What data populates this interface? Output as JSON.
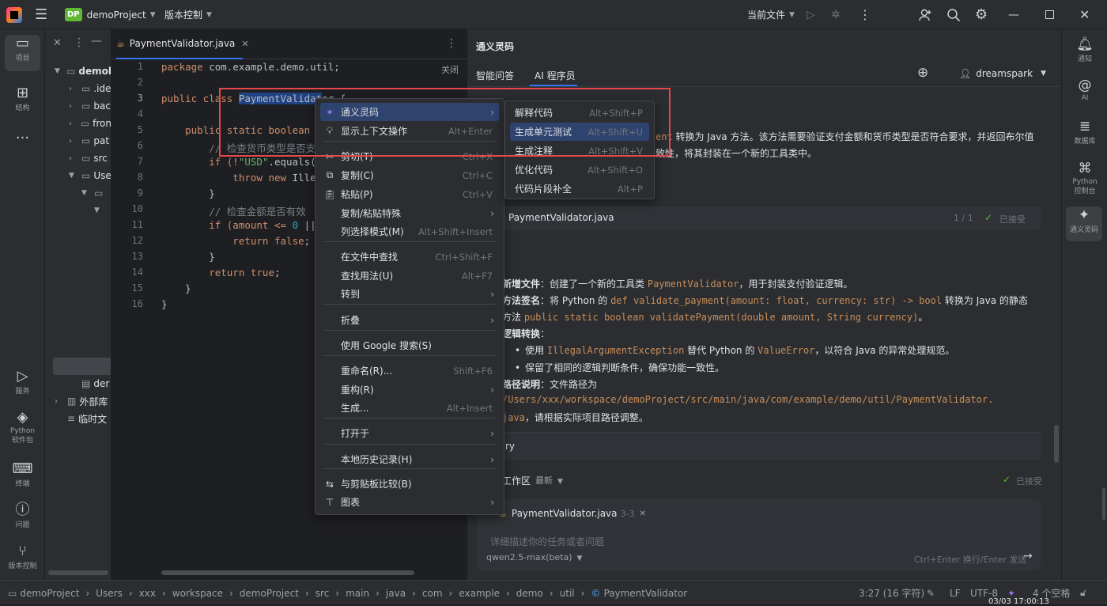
{
  "titlebar": {
    "logo_text": "",
    "project_badge": "DP",
    "project_name": "demoProject",
    "vcs_label": "版本控制",
    "run_config": "当前文件"
  },
  "left_strip": {
    "project": "项目",
    "structure": "结构",
    "more": "...",
    "services": "服务",
    "python_packages": "Python 软件包",
    "terminal": "终端",
    "problems": "问题",
    "vcs": "版本控制"
  },
  "project_tree": {
    "root": "demol",
    "items": [
      ".ide",
      "bac",
      "fron",
      "pat",
      "src",
      "Use",
      "",
      ""
    ],
    "lower": [
      "der",
      "外部库",
      "临时文"
    ]
  },
  "editor": {
    "tab_name": "PaymentValidator.java",
    "close_label": "关闭",
    "line_numbers": [
      "1",
      "2",
      "3",
      "4",
      "5",
      "6",
      "7",
      "8",
      "9",
      "10",
      "11",
      "12",
      "13",
      "14",
      "15",
      "16"
    ],
    "lines": {
      "l1_kw": "package",
      "l1_rest": " com.example.demo.util;",
      "l3_kw": "public class ",
      "l3_sel": "PaymentValidat",
      "l3_rest": "or {",
      "l5_kw": "    public static boolean ",
      "l5_rest": "v",
      "l6": "        // 检查货币类型是否支持",
      "l7_a": "        if (!",
      "l7_str": "\"USD\"",
      "l7_b": ".equals(c",
      "l8_kw": "            throw new ",
      "l8_rest": "Illeg",
      "l9": "        }",
      "l10": "        // 检查金额是否有效",
      "l11_a": "        if (amount <= ",
      "l11_num": "0",
      "l11_b": " ||",
      "l12_kw": "            return false",
      "l12_b": ";",
      "l13": "        }",
      "l14_kw": "        return true",
      "l14_b": ";",
      "l15": "    }",
      "l16": "}"
    }
  },
  "context_menu": {
    "items": [
      {
        "label": "通义灵码",
        "shortcut": "",
        "arrow": "›",
        "icon": "tongyi-icon"
      },
      {
        "label": "显示上下文操作",
        "shortcut": "Alt+Enter",
        "arrow": "",
        "icon": "bulb-icon"
      },
      {
        "label": "剪切(T)",
        "shortcut": "Ctrl+X",
        "arrow": "",
        "icon": "cut-icon"
      },
      {
        "label": "复制(C)",
        "shortcut": "Ctrl+C",
        "arrow": "",
        "icon": "copy-icon"
      },
      {
        "label": "粘贴(P)",
        "shortcut": "Ctrl+V",
        "arrow": "",
        "icon": "paste-icon"
      },
      {
        "label": "复制/粘贴特殊",
        "shortcut": "",
        "arrow": "›",
        "icon": ""
      },
      {
        "label": "列选择模式(M)",
        "shortcut": "Alt+Shift+Insert",
        "arrow": "",
        "icon": ""
      },
      {
        "label": "在文件中查找",
        "shortcut": "Ctrl+Shift+F",
        "arrow": "",
        "icon": ""
      },
      {
        "label": "查找用法(U)",
        "shortcut": "Alt+F7",
        "arrow": "",
        "icon": ""
      },
      {
        "label": "转到",
        "shortcut": "",
        "arrow": "›",
        "icon": ""
      },
      {
        "label": "折叠",
        "shortcut": "",
        "arrow": "›",
        "icon": ""
      },
      {
        "label": "使用 Google 搜索(S)",
        "shortcut": "",
        "arrow": "",
        "icon": ""
      },
      {
        "label": "重命名(R)...",
        "shortcut": "Shift+F6",
        "arrow": "",
        "icon": ""
      },
      {
        "label": "重构(R)",
        "shortcut": "",
        "arrow": "›",
        "icon": ""
      },
      {
        "label": "生成...",
        "shortcut": "Alt+Insert",
        "arrow": "",
        "icon": ""
      },
      {
        "label": "打开于",
        "shortcut": "",
        "arrow": "›",
        "icon": ""
      },
      {
        "label": "本地历史记录(H)",
        "shortcut": "",
        "arrow": "›",
        "icon": ""
      },
      {
        "label": "与剪贴板比较(B)",
        "shortcut": "",
        "arrow": "",
        "icon": "compare-icon"
      },
      {
        "label": "图表",
        "shortcut": "",
        "arrow": "›",
        "icon": "diagram-icon"
      }
    ]
  },
  "submenu": {
    "items": [
      {
        "label": "解释代码",
        "shortcut": "Alt+Shift+P"
      },
      {
        "label": "生成单元测试",
        "shortcut": "Alt+Shift+U"
      },
      {
        "label": "生成注释",
        "shortcut": "Alt+Shift+V"
      },
      {
        "label": "优化代码",
        "shortcut": "Alt+Shift+O"
      },
      {
        "label": "代码片段补全",
        "shortcut": "Alt+P"
      }
    ]
  },
  "ai_panel": {
    "title": "通义灵码",
    "tab_qa": "智能问答",
    "tab_agent": "AI 程序员",
    "user": "dreamspark",
    "intro_tail_code": "ent",
    "intro_line1": " 转换为 Java 方法。该方法需要验证支付金额和货币类型是否符合要求，并返回布尔值",
    "intro_line2": "致性，将其封装在一个新的工具类中。",
    "file_card": {
      "name": "PaymentValidator.java",
      "count": "1 / 1",
      "status": "已接受"
    },
    "bullets": {
      "b1_label": "新增文件",
      "b1_text": "：创建了一个新的工具类 ",
      "b1_code": "PaymentValidator",
      "b1_tail": "，用于封装支付验证逻辑。",
      "b2_label": "方法签名",
      "b2_text": "：将 Python 的 ",
      "b2_code": "def validate_payment(amount: float, currency: str) -> bool",
      "b2_tail": " 转换为 Java 的静态",
      "b2_line2_a": "方法 ",
      "b2_line2_code": "public static boolean validatePayment(double amount, String currency)",
      "b2_line2_b": "。",
      "b3_label": "逻辑转换",
      "b3_colon": "：",
      "b3_s1_a": "使用 ",
      "b3_s1_code": "IllegalArgumentException",
      "b3_s1_b": " 替代 Python 的 ",
      "b3_s1_code2": "ValueError",
      "b3_s1_c": "，以符合 Java 的异常处理规范。",
      "b3_s2": "保留了相同的逻辑判断条件，确保功能一致性。",
      "b4_label": "路径说明",
      "b4_text": "：文件路径为",
      "b4_path1": "/Users/xxx/workspace/demoProject/src/main/java/com/example/demo/util/PaymentValidator.",
      "b4_path2": "java",
      "b4_tail": "，请根据实际项目路径调整。"
    },
    "history_tail": "ry",
    "workspace_label": "工作区",
    "workspace_filter": "最新",
    "workspace_status": "已接受",
    "chip_file": "PaymentValidator.java",
    "chip_range": "3-3",
    "input_placeholder": "详细描述你的任务或者问题",
    "model": "qwen2.5-max(beta)",
    "send_hint": "Ctrl+Enter 换行/Enter 发送"
  },
  "right_strip": {
    "notify": "通知",
    "ai": "AI",
    "database": "数据库",
    "python_console": "Python 控制台",
    "tongyi": "通义灵码"
  },
  "statusbar": {
    "breadcrumb": [
      "demoProject",
      "Users",
      "xxx",
      "workspace",
      "demoProject",
      "src",
      "main",
      "java",
      "com",
      "example",
      "demo",
      "util",
      "PaymentValidator"
    ],
    "position": "3:27 (16 字符)",
    "line_sep": "LF",
    "encoding": "UTF-8",
    "indent": "4 个空格",
    "clock": "03/03 17:00:13"
  },
  "colors": {
    "accent": "#3574f0",
    "highlight_box": "#e5484d",
    "menu_hover": "#2e436e"
  }
}
